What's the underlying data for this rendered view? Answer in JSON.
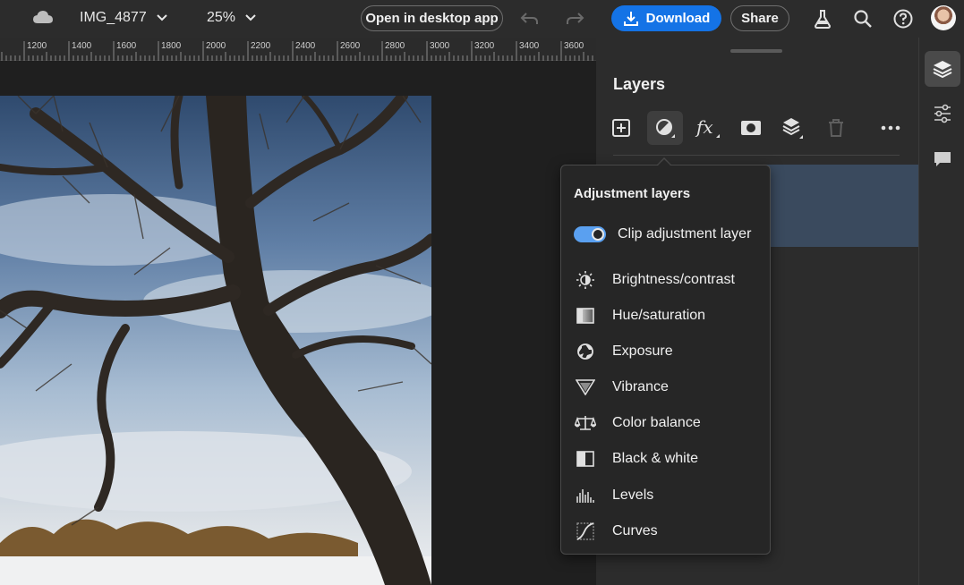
{
  "header": {
    "doc_name": "IMG_4877",
    "zoom": "25%",
    "open_desktop_label": "Open in desktop app",
    "download_label": "Download",
    "share_label": "Share"
  },
  "ruler": {
    "ticks": [
      "1200",
      "1400",
      "1600",
      "1800",
      "2000",
      "2200",
      "2400",
      "2600",
      "2800",
      "3000",
      "3200",
      "3400",
      "3600"
    ]
  },
  "layers_panel": {
    "title": "Layers",
    "tools": [
      "add-layer-icon",
      "adjustment-layer-icon",
      "fx-icon",
      "mask-icon",
      "stack-icon",
      "delete-icon",
      "more-icon"
    ],
    "layer_name_fragment": "r 0"
  },
  "adjustment_popover": {
    "title": "Adjustment layers",
    "clip_label": "Clip adjustment layer",
    "clip_enabled": true,
    "items": [
      {
        "label": "Brightness/contrast",
        "icon": "brightness-icon"
      },
      {
        "label": "Hue/saturation",
        "icon": "hue-saturation-icon"
      },
      {
        "label": "Exposure",
        "icon": "exposure-icon"
      },
      {
        "label": "Vibrance",
        "icon": "vibrance-icon"
      },
      {
        "label": "Color balance",
        "icon": "color-balance-icon"
      },
      {
        "label": "Black & white",
        "icon": "black-white-icon"
      },
      {
        "label": "Levels",
        "icon": "levels-icon"
      },
      {
        "label": "Curves",
        "icon": "curves-icon"
      }
    ]
  },
  "colors": {
    "accent": "#1473e6",
    "toggle_on": "#5aa0f0",
    "selected_layer": "#3a4a5e"
  }
}
